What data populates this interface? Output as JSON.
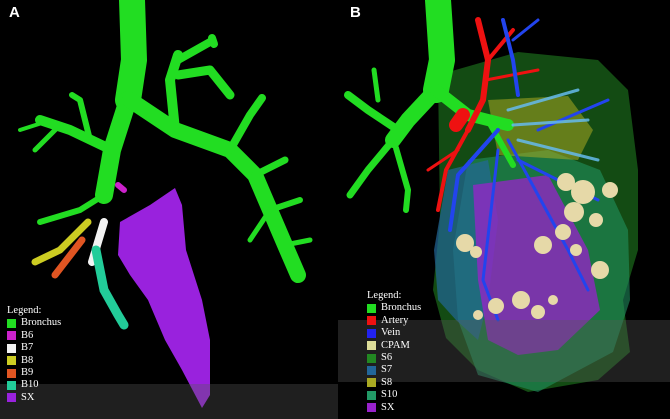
{
  "panels": [
    {
      "letter": "A",
      "legend": {
        "title": "Legend:",
        "items": [
          {
            "label": "Bronchus",
            "color": "#22dd22"
          },
          {
            "label": "B6",
            "color": "#cc22cc"
          },
          {
            "label": "B7",
            "color": "#f2f2f2"
          },
          {
            "label": "B8",
            "color": "#cccc22"
          },
          {
            "label": "B9",
            "color": "#e05522"
          },
          {
            "label": "B10",
            "color": "#22cc99"
          },
          {
            "label": "SX",
            "color": "#9922dd"
          }
        ]
      }
    },
    {
      "letter": "B",
      "legend": {
        "title": "Legend:",
        "items": [
          {
            "label": "Bronchus",
            "color": "#22dd22"
          },
          {
            "label": "Artery",
            "color": "#ee1111"
          },
          {
            "label": "Vein",
            "color": "#2222ee"
          },
          {
            "label": "CPAM",
            "color": "#dddd99"
          },
          {
            "label": "S6",
            "color": "#228822"
          },
          {
            "label": "S7",
            "color": "#226699"
          },
          {
            "label": "S8",
            "color": "#aaaa22"
          },
          {
            "label": "S10",
            "color": "#229966"
          },
          {
            "label": "SX",
            "color": "#9922cc"
          }
        ]
      }
    }
  ]
}
